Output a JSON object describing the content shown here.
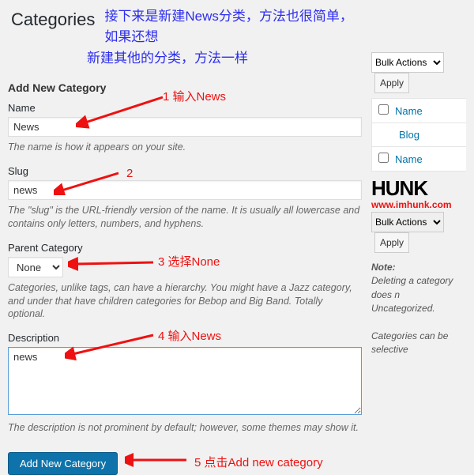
{
  "page": {
    "title": "Categories"
  },
  "banner": {
    "line1": "接下来是新建News分类，方法也很简单，如果还想",
    "line2": "新建其他的分类，方法一样"
  },
  "form": {
    "section_heading": "Add New Category",
    "name": {
      "label": "Name",
      "value": "News",
      "help": "The name is how it appears on your site."
    },
    "slug": {
      "label": "Slug",
      "value": "news",
      "help": "The \"slug\" is the URL-friendly version of the name. It is usually all lowercase and contains only letters, numbers, and hyphens."
    },
    "parent": {
      "label": "Parent Category",
      "value": "None",
      "help": "Categories, unlike tags, can have a hierarchy. You might have a Jazz category, and under that have children categories for Bebop and Big Band. Totally optional."
    },
    "description": {
      "label": "Description",
      "value": "news",
      "help": "The description is not prominent by default; however, some themes may show it."
    },
    "submit_label": "Add New Category"
  },
  "annotations": {
    "a1": "1 输入News",
    "a2": "2",
    "a3": "3 选择None",
    "a4": "4 输入News",
    "a5": "5    点击Add new category"
  },
  "sidebar": {
    "bulk_actions_label": "Bulk Actions",
    "apply_label": "Apply",
    "col_name": "Name",
    "row_blog": "Blog",
    "logo_text": "HUNK",
    "logo_url": "www.imhunk.com",
    "note_label": "Note:",
    "note_line1": "Deleting a category does n",
    "note_line1b": "Uncategorized.",
    "note_line2": "Categories can be selective"
  }
}
